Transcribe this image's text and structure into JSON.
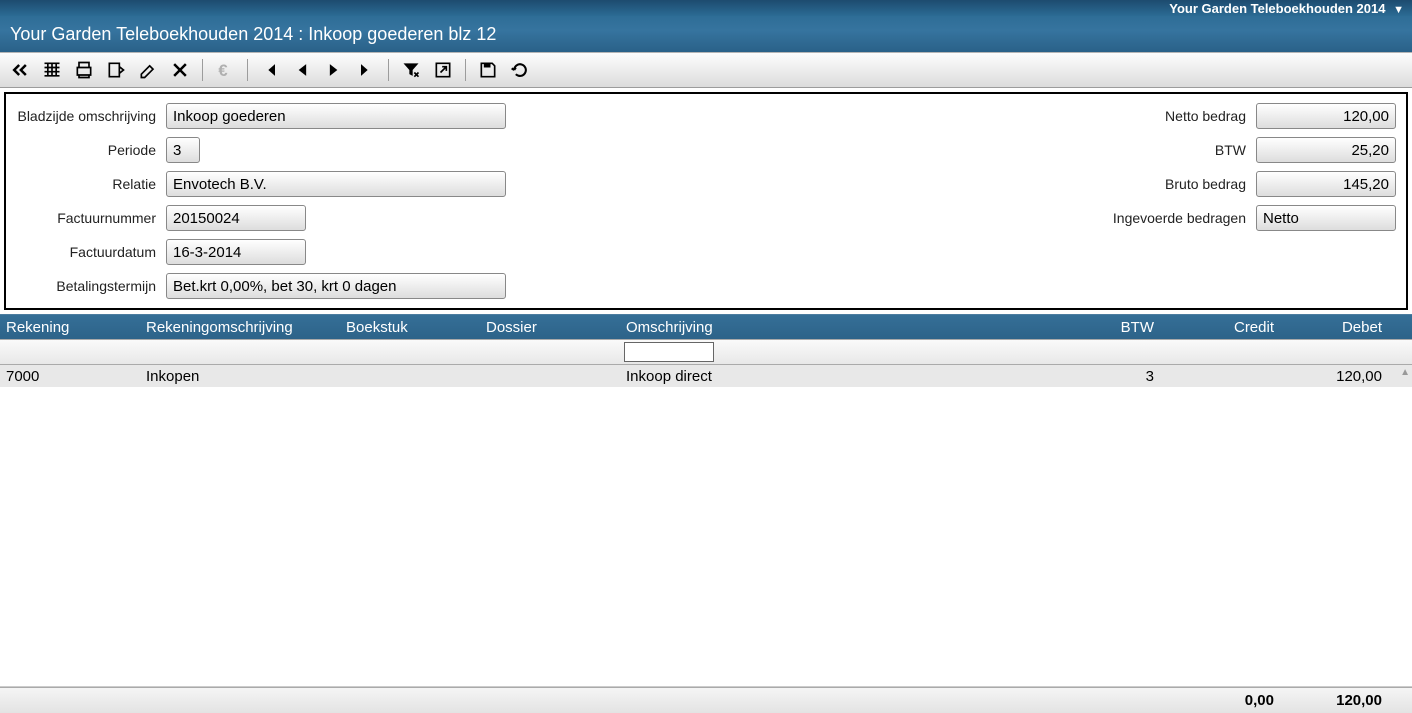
{
  "topbar": {
    "app_label": "Your Garden Teleboekhouden 2014"
  },
  "titlebar": {
    "text": "Your Garden Teleboekhouden 2014 : Inkoop goederen blz 12"
  },
  "toolbar": {
    "icons": [
      "back-icon",
      "grid-icon",
      "print-icon",
      "export-icon",
      "edit-icon",
      "delete-icon",
      "sep",
      "euro-icon",
      "sep",
      "first-icon",
      "prev-icon",
      "next-icon",
      "last-icon",
      "sep",
      "filter-icon",
      "popout-icon",
      "sep",
      "save-icon",
      "refresh-icon"
    ]
  },
  "form": {
    "bladzijde_label": "Bladzijde omschrijving",
    "bladzijde_value": "Inkoop goederen",
    "periode_label": "Periode",
    "periode_value": "3",
    "relatie_label": "Relatie",
    "relatie_value": "Envotech B.V.",
    "factuurnummer_label": "Factuurnummer",
    "factuurnummer_value": "20150024",
    "factuurdatum_label": "Factuurdatum",
    "factuurdatum_value": "16-3-2014",
    "betalingstermijn_label": "Betalingstermijn",
    "betalingstermijn_value": "Bet.krt 0,00%, bet 30, krt 0 dagen",
    "netto_label": "Netto bedrag",
    "netto_value": "120,00",
    "btw_label": "BTW",
    "btw_value": "25,20",
    "bruto_label": "Bruto bedrag",
    "bruto_value": "145,20",
    "ingevoerd_label": "Ingevoerde bedragen",
    "ingevoerd_value": "Netto"
  },
  "grid": {
    "headers": {
      "rekening": "Rekening",
      "rekeningomschrijving": "Rekeningomschrijving",
      "boekstuk": "Boekstuk",
      "dossier": "Dossier",
      "omschrijving": "Omschrijving",
      "btw": "BTW",
      "credit": "Credit",
      "debet": "Debet"
    },
    "filter": {
      "omschrijving": ""
    },
    "rows": [
      {
        "rekening": "7000",
        "rekeningomschrijving": "Inkopen",
        "boekstuk": "",
        "dossier": "",
        "omschrijving": "Inkoop direct",
        "btw": "3",
        "credit": "",
        "debet": "120,00"
      }
    ],
    "footer": {
      "credit": "0,00",
      "debet": "120,00"
    }
  }
}
